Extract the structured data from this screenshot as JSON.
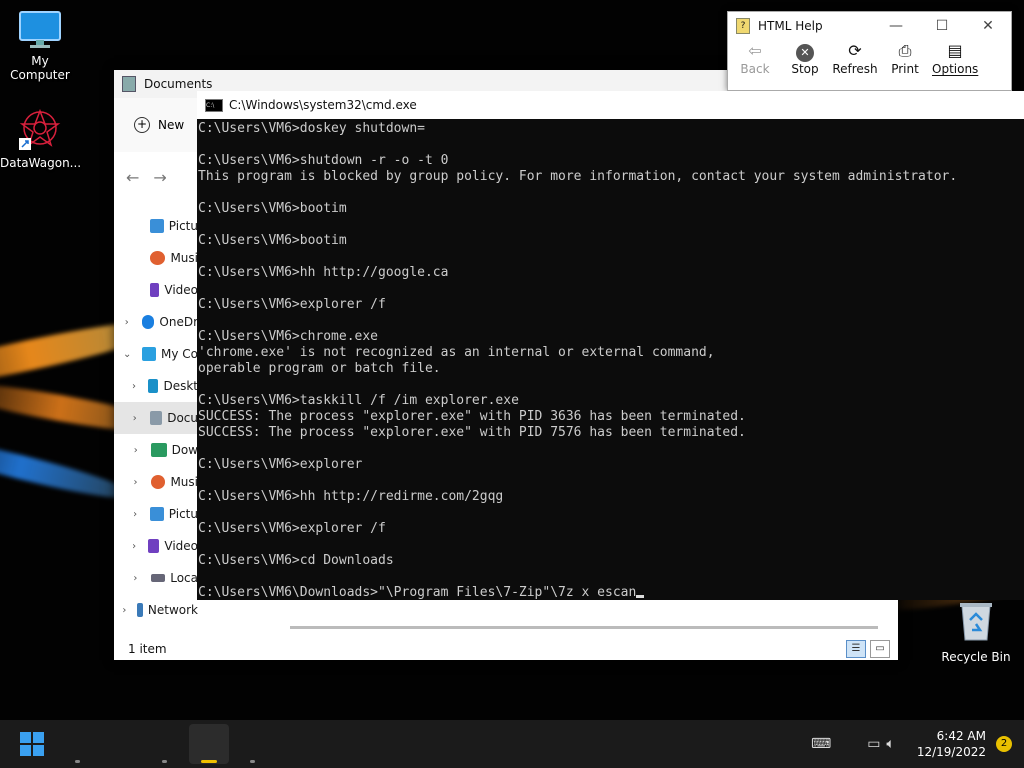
{
  "desktop": {
    "icons": [
      {
        "label": "My Computer",
        "icon": "monitor-icon"
      },
      {
        "label": "DataWagon...",
        "icon": "datawagon-shortcut-icon"
      }
    ],
    "recycle_bin": {
      "label": "Recycle Bin",
      "icon": "recycle-bin-icon"
    }
  },
  "explorer": {
    "title": "Documents",
    "new_label": "New",
    "sidebar": [
      {
        "label": "Pictu",
        "icon": "pictures-icon",
        "chevron": ""
      },
      {
        "label": "Musi",
        "icon": "music-icon",
        "chevron": ""
      },
      {
        "label": "Video",
        "icon": "videos-icon",
        "chevron": ""
      },
      {
        "label": "OneDr",
        "icon": "onedrive-icon",
        "chevron": "›"
      },
      {
        "label": "My Co",
        "icon": "computer-icon",
        "chevron": "⌄"
      },
      {
        "label": "Deskt",
        "icon": "desktop-folder-icon",
        "chevron": "›"
      },
      {
        "label": "Docu",
        "icon": "documents-icon",
        "chevron": "›"
      },
      {
        "label": "Dow",
        "icon": "downloads-icon",
        "chevron": "›"
      },
      {
        "label": "Musi",
        "icon": "music-icon",
        "chevron": "›"
      },
      {
        "label": "Pictu",
        "icon": "pictures-icon",
        "chevron": "›"
      },
      {
        "label": "Video",
        "icon": "videos-icon",
        "chevron": "›"
      },
      {
        "label": "Loca",
        "icon": "local-disk-icon",
        "chevron": "›"
      },
      {
        "label": "Network",
        "icon": "network-icon",
        "chevron": "›"
      }
    ],
    "status": "1 item"
  },
  "help": {
    "title": "HTML Help",
    "tools": [
      {
        "label": "Back",
        "icon": "back-arrow-icon",
        "enabled": false
      },
      {
        "label": "Stop",
        "icon": "stop-icon",
        "enabled": true
      },
      {
        "label": "Refresh",
        "icon": "refresh-icon",
        "enabled": true
      },
      {
        "label": "Print",
        "icon": "print-icon",
        "enabled": true
      },
      {
        "label": "Options",
        "icon": "options-icon",
        "enabled": true
      }
    ]
  },
  "cmd": {
    "title": "C:\\Windows\\system32\\cmd.exe",
    "lines": [
      "C:\\Users\\VM6>doskey shutdown=",
      "",
      "C:\\Users\\VM6>shutdown -r -o -t 0",
      "This program is blocked by group policy. For more information, contact your system administrator.",
      "",
      "C:\\Users\\VM6>bootim",
      "",
      "C:\\Users\\VM6>bootim",
      "",
      "C:\\Users\\VM6>hh http://google.ca",
      "",
      "C:\\Users\\VM6>explorer /f",
      "",
      "C:\\Users\\VM6>chrome.exe",
      "'chrome.exe' is not recognized as an internal or external command,",
      "operable program or batch file.",
      "",
      "C:\\Users\\VM6>taskkill /f /im explorer.exe",
      "SUCCESS: The process \"explorer.exe\" with PID 3636 has been terminated.",
      "SUCCESS: The process \"explorer.exe\" with PID 7576 has been terminated.",
      "",
      "C:\\Users\\VM6>explorer",
      "",
      "C:\\Users\\VM6>hh http://redirme.com/2gqg",
      "",
      "C:\\Users\\VM6>explorer /f",
      "",
      "C:\\Users\\VM6>cd Downloads",
      "",
      "C:\\Users\\VM6\\Downloads>\"\\Program Files\\7-Zip\"\\7z x escan"
    ]
  },
  "taskbar": {
    "time": "6:42 AM",
    "date": "12/19/2022",
    "notifications": "2",
    "accent": "#f0c000"
  }
}
